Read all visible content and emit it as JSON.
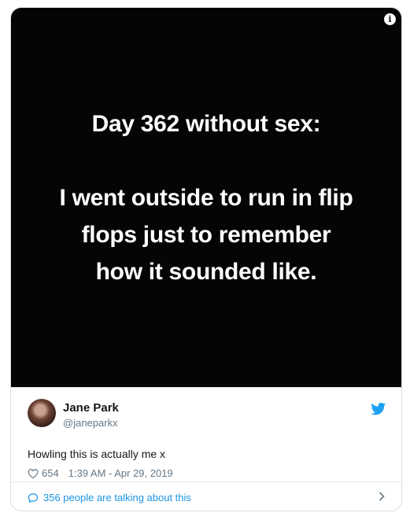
{
  "media": {
    "line1": "Day 362 without sex:",
    "line2": "I went outside to run in flip",
    "line3": "flops just to remember",
    "line4": "how it sounded like.",
    "info_icon": "i"
  },
  "tweet": {
    "author_name": "Jane Park",
    "author_handle": "@janeparkx",
    "text": "Howling this is actually me x",
    "likes": "654",
    "timestamp": "1:39 AM - Apr 29, 2019"
  },
  "footer": {
    "talking": "356 people are talking about this"
  },
  "colors": {
    "accent": "#1da1f2",
    "link": "#1b95e0",
    "muted": "#657786",
    "media_bg": "#050505"
  },
  "icons": {
    "info": "info-icon",
    "bird": "twitter-bird-icon",
    "heart": "heart-icon",
    "bubble": "speech-bubble-icon",
    "chevron": "chevron-right-icon"
  }
}
